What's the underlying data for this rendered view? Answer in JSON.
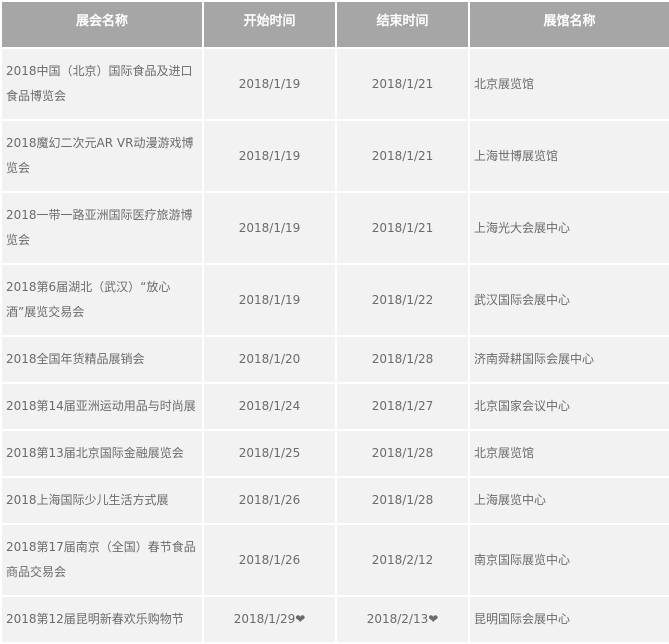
{
  "table": {
    "headers": [
      "展会名称",
      "开始时间",
      "结束时间",
      "展馆名称"
    ],
    "rows": [
      {
        "name": "2018中国（北京）国际食品及进口食品博览会",
        "start": "2018/1/19",
        "end": "2018/1/21",
        "venue": "北京展览馆"
      },
      {
        "name": "2018魔幻二次元AR VR动漫游戏博览会",
        "start": "2018/1/19",
        "end": "2018/1/21",
        "venue": "上海世博展览馆"
      },
      {
        "name": "2018一带一路亚洲国际医疗旅游博览会",
        "start": "2018/1/19",
        "end": "2018/1/21",
        "venue": "上海光大会展中心"
      },
      {
        "name": "2018第6届湖北（武汉）“放心酒”展览交易会",
        "start": "2018/1/19",
        "end": "2018/1/22",
        "venue": "武汉国际会展中心"
      },
      {
        "name": "2018全国年货精品展销会",
        "start": "2018/1/20",
        "end": "2018/1/28",
        "venue": "济南舜耕国际会展中心"
      },
      {
        "name": "2018第14届亚洲运动用品与时尚展",
        "start": "2018/1/24",
        "end": "2018/1/27",
        "venue": "北京国家会议中心"
      },
      {
        "name": "2018第13届北京国际金融展览会",
        "start": "2018/1/25",
        "end": "2018/1/28",
        "venue": "北京展览馆"
      },
      {
        "name": "2018上海国际少儿生活方式展",
        "start": "2018/1/26",
        "end": "2018/1/28",
        "venue": "上海展览中心"
      },
      {
        "name": "2018第17届南京（全国）春节食品商品交易会",
        "start": "2018/1/26",
        "end": "2018/2/12",
        "venue": "南京国际展览中心"
      },
      {
        "name": "2018第12届昆明新春欢乐购物节",
        "start": "2018/1/29❤",
        "end": "2018/2/13❤",
        "venue": "昆明国际会展中心"
      }
    ]
  }
}
